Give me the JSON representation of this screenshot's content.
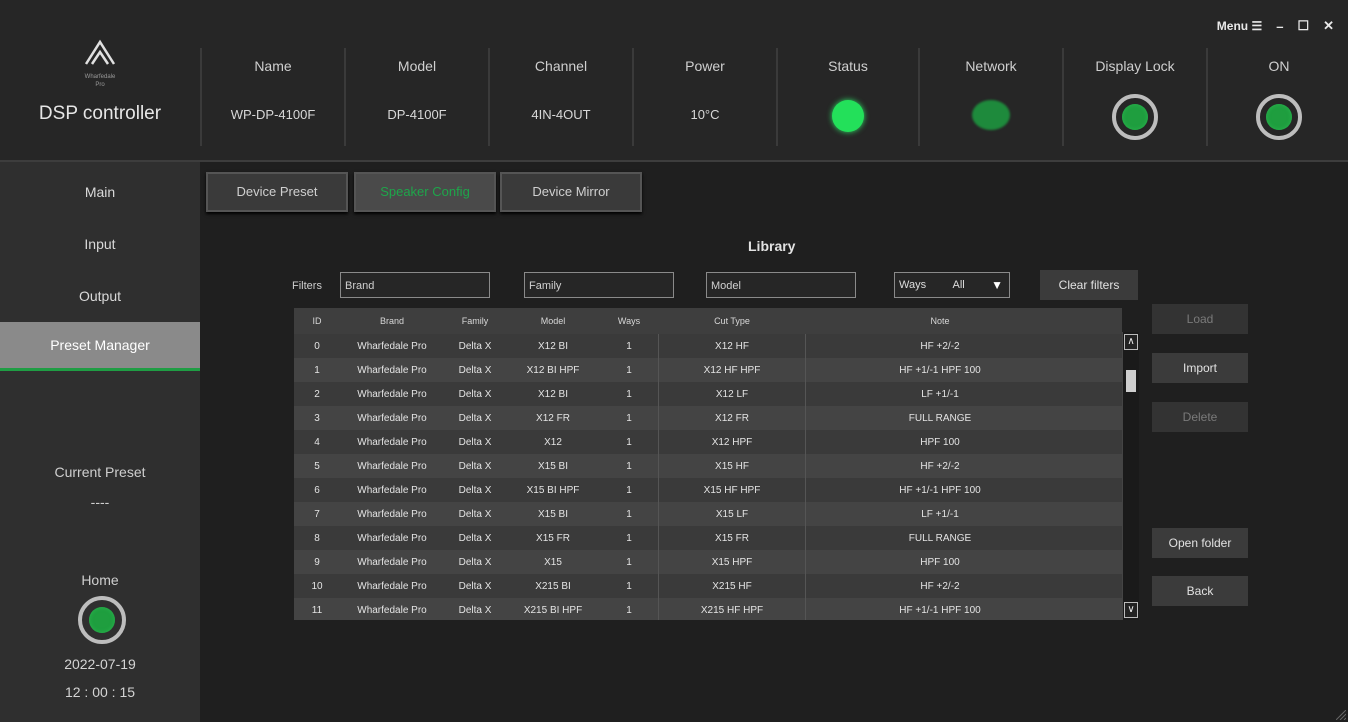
{
  "window": {
    "menu_label": "Menu ☰",
    "minimize": "–",
    "maximize": "☐",
    "close": "✕"
  },
  "app": {
    "title": "DSP controller",
    "logo_text_1": "Wharfedale",
    "logo_text_2": "Pro"
  },
  "device": {
    "name_label": "Name",
    "name_value": "WP-DP-4100F",
    "model_label": "Model",
    "model_value": "DP-4100F",
    "channel_label": "Channel",
    "channel_value": "4IN-4OUT",
    "power_label": "Power",
    "power_value": "10°C",
    "status_label": "Status",
    "network_label": "Network",
    "display_lock_label": "Display Lock",
    "on_label": "ON"
  },
  "sidebar": {
    "items": [
      {
        "label": "Main"
      },
      {
        "label": "Input"
      },
      {
        "label": "Output"
      },
      {
        "label": "Preset Manager"
      }
    ],
    "current_preset_label": "Current Preset",
    "current_preset_value": "----",
    "home_label": "Home",
    "date": "2022-07-19",
    "time": "12 : 00 : 15"
  },
  "tabs": [
    {
      "label": "Device Preset"
    },
    {
      "label": "Speaker Config"
    },
    {
      "label": "Device Mirror"
    }
  ],
  "library": {
    "title": "Library",
    "filters_label": "Filters",
    "brand_placeholder": "Brand",
    "family_placeholder": "Family",
    "model_placeholder": "Model",
    "ways_label": "Ways",
    "ways_value": "All",
    "clear_filters": "Clear filters",
    "columns": [
      "ID",
      "Brand",
      "Family",
      "Model",
      "Ways",
      "Cut Type",
      "Note"
    ],
    "rows": [
      [
        "0",
        "Wharfedale Pro",
        "Delta X",
        "X12 BI",
        "1",
        "X12 HF",
        "HF +2/-2"
      ],
      [
        "1",
        "Wharfedale Pro",
        "Delta X",
        "X12 BI HPF",
        "1",
        "X12 HF HPF",
        "HF +1/-1 HPF 100"
      ],
      [
        "2",
        "Wharfedale Pro",
        "Delta X",
        "X12 BI",
        "1",
        "X12 LF",
        "LF +1/-1"
      ],
      [
        "3",
        "Wharfedale Pro",
        "Delta X",
        "X12 FR",
        "1",
        "X12 FR",
        "FULL RANGE"
      ],
      [
        "4",
        "Wharfedale Pro",
        "Delta X",
        "X12",
        "1",
        "X12 HPF",
        "HPF 100"
      ],
      [
        "5",
        "Wharfedale Pro",
        "Delta X",
        "X15 BI",
        "1",
        "X15 HF",
        "HF +2/-2"
      ],
      [
        "6",
        "Wharfedale Pro",
        "Delta X",
        "X15 BI HPF",
        "1",
        "X15 HF HPF",
        "HF +1/-1 HPF 100"
      ],
      [
        "7",
        "Wharfedale Pro",
        "Delta X",
        "X15 BI",
        "1",
        "X15 LF",
        "LF +1/-1"
      ],
      [
        "8",
        "Wharfedale Pro",
        "Delta X",
        "X15 FR",
        "1",
        "X15 FR",
        "FULL RANGE"
      ],
      [
        "9",
        "Wharfedale Pro",
        "Delta X",
        "X15",
        "1",
        "X15 HPF",
        "HPF 100"
      ],
      [
        "10",
        "Wharfedale Pro",
        "Delta X",
        "X215 BI",
        "1",
        "X215 HF",
        "HF +2/-2"
      ],
      [
        "11",
        "Wharfedale Pro",
        "Delta X",
        "X215 BI HPF",
        "1",
        "X215 HF HPF",
        "HF +1/-1 HPF 100"
      ]
    ]
  },
  "actions": {
    "load": "Load",
    "import": "Import",
    "delete": "Delete",
    "open_folder": "Open folder",
    "back": "Back"
  },
  "colors": {
    "accent_green": "#1ea64a",
    "status_green": "#23e05a",
    "header_bg": "#262626",
    "main_bg": "#1f1f1f"
  },
  "icons": {
    "logo": "wharfedale-logo-icon",
    "menu": "menu-icon",
    "status": "status-indicator-icon",
    "network": "network-indicator-icon",
    "display_lock": "display-lock-toggle-icon",
    "power": "power-toggle-icon",
    "home": "home-toggle-icon",
    "ways_dropdown": "chevron-down-icon"
  }
}
